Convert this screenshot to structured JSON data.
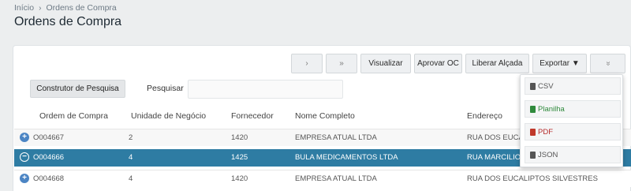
{
  "breadcrumb": {
    "home": "Início",
    "separator": "›",
    "current": "Ordens de Compra"
  },
  "page_title": "Ordens de Compra",
  "toolbar": {
    "next": "›",
    "last": "»",
    "view": "Visualizar",
    "approve": "Aprovar OC",
    "release": "Liberar Alçada",
    "export": "Exportar ▼",
    "more": "»"
  },
  "search": {
    "builder": "Construtor de Pesquisa",
    "label": "Pesquisar",
    "value": ""
  },
  "table": {
    "headers": [
      "Ordem de Compra",
      "Unidade de Negócio",
      "Fornecedor",
      "Nome Completo",
      "Endereço"
    ],
    "rows": [
      {
        "expand": "+",
        "order": "O004667",
        "unit": "2",
        "supplier": "1420",
        "name": "EMPRESA ATUAL LTDA",
        "address": "RUA DOS EUCAL"
      },
      {
        "expand": "−",
        "order": "O004666",
        "unit": "4",
        "supplier": "1425",
        "name": "BULA MEDICAMENTOS LTDA",
        "address": "RUA MARCILIO D"
      },
      {
        "expand": "+",
        "order": "O004668",
        "unit": "4",
        "supplier": "1420",
        "name": "EMPRESA ATUAL LTDA",
        "address": "RUA DOS EUCALIPTOS SILVESTRES"
      }
    ]
  },
  "export_menu": {
    "csv": "CSV",
    "xls": "Planilha",
    "pdf": "PDF",
    "json": "JSON"
  },
  "colors": {
    "selected_row": "#2e7ca3",
    "expand_icon": "#4c85c4",
    "xls": "#2f8a3c",
    "pdf": "#b52a2a"
  },
  "icons": {
    "csv": "file-csv-icon",
    "xls": "file-excel-icon",
    "pdf": "file-pdf-icon",
    "json": "file-json-icon"
  }
}
